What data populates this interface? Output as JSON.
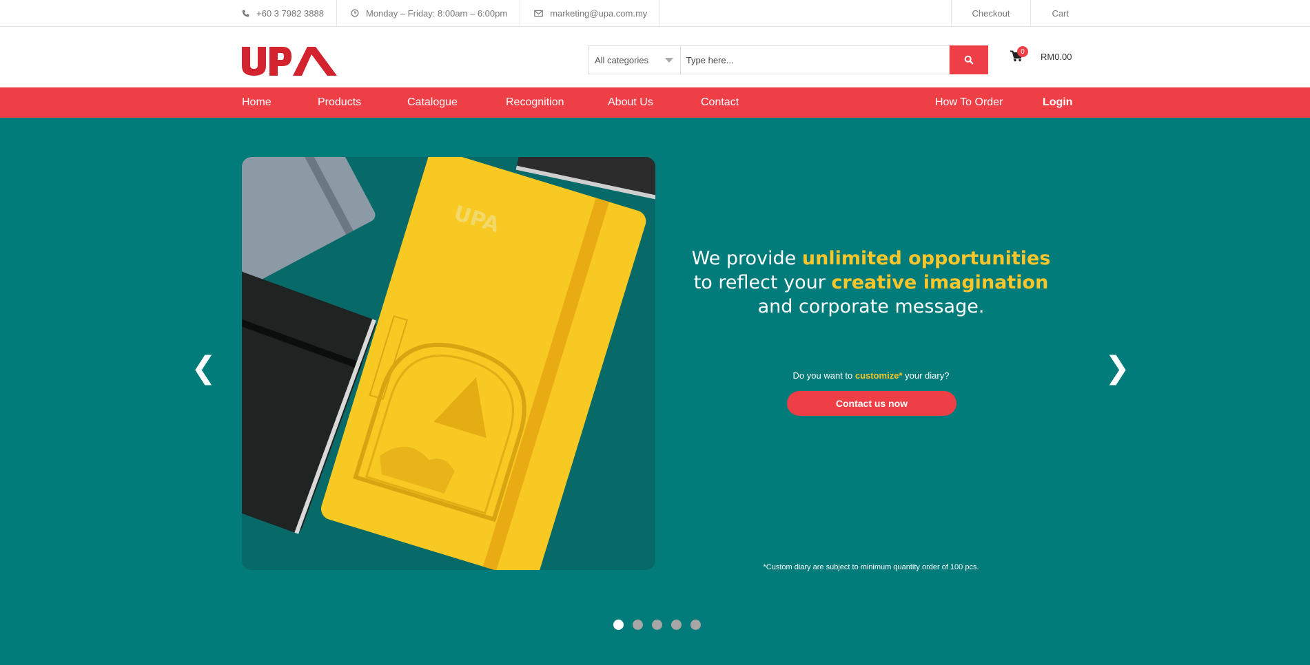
{
  "topbar": {
    "phone": "+60 3 7982 3888",
    "hours": "Monday – Friday: 8:00am – 6:00pm",
    "email": "marketing@upa.com.my",
    "checkout": "Checkout",
    "cart": "Cart"
  },
  "header": {
    "logo_text": "UPA",
    "category_select": "All categories",
    "search_placeholder": "Type here...",
    "cart_count": "0",
    "cart_total": "RM0.00"
  },
  "nav": {
    "items": [
      "Home",
      "Products",
      "Catalogue",
      "Recognition",
      "About Us",
      "Contact"
    ],
    "how_to_order": "How To Order",
    "login": "Login"
  },
  "hero": {
    "line1_a": "We provide ",
    "line1_b": "unlimited opportunities",
    "line2_a": "to reflect your ",
    "line2_b": "creative imagination",
    "line3": "and corporate message.",
    "sub_a": "Do you want to ",
    "sub_b": "customize*",
    "sub_c": " your diary?",
    "cta": "Contact us now",
    "footnote": "*Custom diary are subject to minimum quantity order of 100 pcs.",
    "notebook_brand": "UPA",
    "prev_arrow": "❮",
    "next_arrow": "❯",
    "slide_count": 5,
    "active_slide": 1
  },
  "colors": {
    "brand_red": "#ee3e46",
    "hero_teal": "#027b7b",
    "highlight_yellow": "#f8c52a"
  }
}
